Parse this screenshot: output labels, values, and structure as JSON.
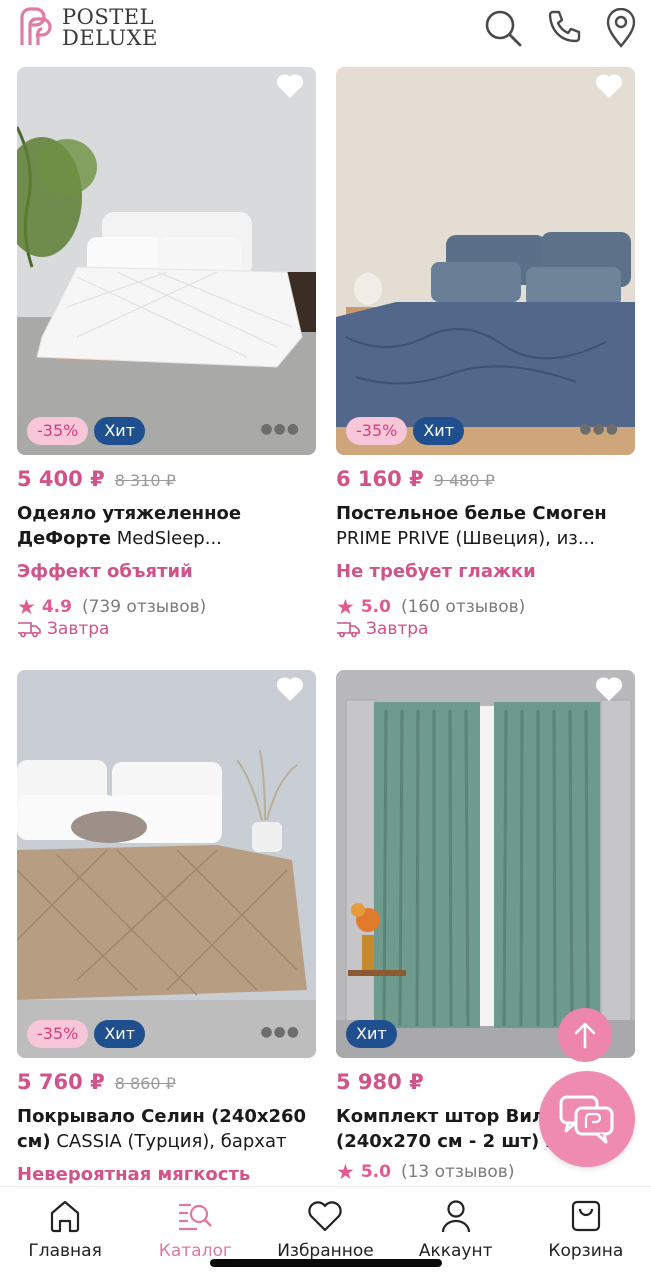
{
  "header": {
    "logo_line1": "POSTEL",
    "logo_line2": "DELUXE",
    "icons": [
      "search-icon",
      "phone-icon",
      "location-icon"
    ]
  },
  "products": [
    {
      "price": "5 400 ₽",
      "old_price": "8 310 ₽",
      "title_bold": "Одеяло утяжеленное ДеФорте",
      "title_rest": " MedSleep...",
      "feature": "Эффект объятий",
      "rating": "4.9",
      "reviews": "(739 отзывов)",
      "delivery": "Завтра",
      "badge_sale": "-35%",
      "badge_hit": "Хит"
    },
    {
      "price": "6 160 ₽",
      "old_price": "9 480 ₽",
      "title_bold": "Постельное белье Смоген",
      "title_rest": " PRIME PRIVE (Швеция), из...",
      "feature": "Не требует глажки",
      "rating": "5.0",
      "reviews": "(160 отзывов)",
      "delivery": "Завтра",
      "badge_sale": "-35%",
      "badge_hit": "Хит"
    },
    {
      "price": "5 760 ₽",
      "old_price": "8 860 ₽",
      "title_bold": "Покрывало Селин (240x260 см)",
      "title_rest": " CASSIA (Турция), бархат",
      "feature": "Невероятная мягкость",
      "badge_sale": "-35%",
      "badge_hit": "Хит"
    },
    {
      "price": "5 980 ₽",
      "title_bold": "Комплект штор Вил... (240x270 см - 2 шт)",
      "title_rest": " ES...",
      "rating": "5.0",
      "reviews": "(13 отзывов)",
      "badge_hit": "Хит"
    }
  ],
  "nav": [
    {
      "label": "Главная",
      "icon": "home-icon"
    },
    {
      "label": "Каталог",
      "icon": "catalog-search-icon",
      "active": true
    },
    {
      "label": "Избранное",
      "icon": "heart-icon"
    },
    {
      "label": "Аккаунт",
      "icon": "user-icon"
    },
    {
      "label": "Корзина",
      "icon": "bag-icon"
    }
  ],
  "colors": {
    "accent": "#d0538a",
    "sale_badge_bg": "#f7c6d9",
    "hit_badge_bg": "#1f4f8f",
    "chat_button": "#ef8bb1"
  }
}
